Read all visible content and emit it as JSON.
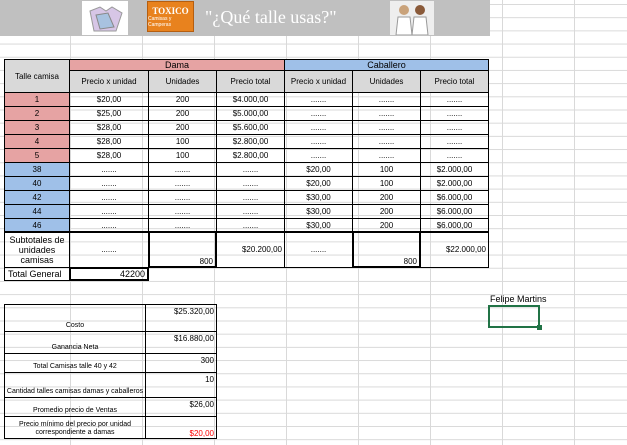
{
  "banner": {
    "logo_text": "TOXICO",
    "logo_sub": "Camisas y Camperas",
    "slogan": "\"¿Qué talle usas?\""
  },
  "table": {
    "size_header": "Talle camisa",
    "dama_header": "Dama",
    "caballero_header": "Caballero",
    "subheaders": [
      "Precio x unidad",
      "Unidades",
      "Precio total",
      "Precio x unidad",
      "Unidades",
      "Precio total"
    ],
    "rows": [
      {
        "size": "1",
        "d_price": "$20,00",
        "d_units": "200",
        "d_total": "$4.000,00",
        "c_price": ".......",
        "c_units": ".......",
        "c_total": "......."
      },
      {
        "size": "2",
        "d_price": "$25,00",
        "d_units": "200",
        "d_total": "$5.000,00",
        "c_price": ".......",
        "c_units": ".......",
        "c_total": "......."
      },
      {
        "size": "3",
        "d_price": "$28,00",
        "d_units": "200",
        "d_total": "$5.600,00",
        "c_price": ".......",
        "c_units": ".......",
        "c_total": "......."
      },
      {
        "size": "4",
        "d_price": "$28,00",
        "d_units": "100",
        "d_total": "$2.800,00",
        "c_price": ".......",
        "c_units": ".......",
        "c_total": "......."
      },
      {
        "size": "5",
        "d_price": "$28,00",
        "d_units": "100",
        "d_total": "$2.800,00",
        "c_price": ".......",
        "c_units": ".......",
        "c_total": "......."
      },
      {
        "size": "38",
        "d_price": ".......",
        "d_units": ".......",
        "d_total": ".......",
        "c_price": "$20,00",
        "c_units": "100",
        "c_total": "$2.000,00"
      },
      {
        "size": "40",
        "d_price": ".......",
        "d_units": ".......",
        "d_total": ".......",
        "c_price": "$20,00",
        "c_units": "100",
        "c_total": "$2.000,00"
      },
      {
        "size": "42",
        "d_price": ".......",
        "d_units": ".......",
        "d_total": ".......",
        "c_price": "$30,00",
        "c_units": "200",
        "c_total": "$6.000,00"
      },
      {
        "size": "44",
        "d_price": ".......",
        "d_units": ".......",
        "d_total": ".......",
        "c_price": "$30,00",
        "c_units": "200",
        "c_total": "$6.000,00"
      },
      {
        "size": "46",
        "d_price": ".......",
        "d_units": ".......",
        "d_total": ".......",
        "c_price": "$30,00",
        "c_units": "200",
        "c_total": "$6.000,00"
      }
    ],
    "subtotal_label": "Subtotales de unidades camisas",
    "subtotal": {
      "d_price": ".......",
      "d_units": "800",
      "d_total": "$20.200,00",
      "c_price": ".......",
      "c_units": "800",
      "c_total": "$22.000,00"
    },
    "total_general_label": "Total General",
    "total_general_value": "42200"
  },
  "summary": [
    {
      "label": "Costo",
      "value": "$25.320,00",
      "red": false
    },
    {
      "label": "Ganancia Neta",
      "value": "$16.880,00",
      "red": false
    },
    {
      "label": "Total Camisas talle 40 y 42",
      "value": "300",
      "red": false
    },
    {
      "label": "Cantidad talles camisas damas y caballeros",
      "value": "10",
      "red": false
    },
    {
      "label": "Promedio precio de Ventas",
      "value": "$26,00",
      "red": false
    },
    {
      "label": "Precio mínimo del precio por unidad correspondiente a damas",
      "value": "$20,00",
      "red": true
    }
  ],
  "author": "Felipe Martins",
  "colors": {
    "dama": "#e6a3a3",
    "caballero": "#9fc0e8",
    "selection": "#217346",
    "warning": "#ff0000"
  }
}
